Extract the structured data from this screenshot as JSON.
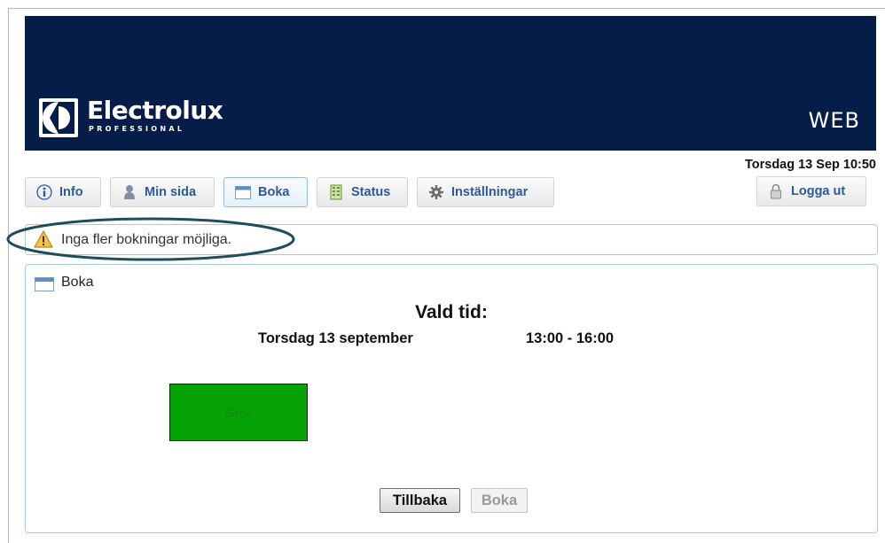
{
  "header": {
    "brand": "Electrolux",
    "brand_sub": "PROFESSIONAL",
    "app_label": "WEB",
    "banner_color": "#071d49"
  },
  "datetime": "Torsdag 13 Sep 10:50",
  "nav": {
    "tabs": [
      {
        "label": "Info",
        "icon": "info-icon"
      },
      {
        "label": "Min sida",
        "icon": "user-icon"
      },
      {
        "label": "Boka",
        "icon": "calendar-icon",
        "active": true
      },
      {
        "label": "Status",
        "icon": "building-icon"
      },
      {
        "label": "Inställningar",
        "icon": "gear-icon"
      }
    ],
    "logout": {
      "label": "Logga ut",
      "icon": "lock-icon"
    }
  },
  "alert": {
    "text": "Inga fler bokningar möjliga.",
    "icon": "warning-icon",
    "highlight_color": "#1e4e5e"
  },
  "panel": {
    "title": "Boka",
    "icon": "calendar-icon",
    "heading": "Vald tid:",
    "day": "Torsdag 13 september",
    "time": "13:00 - 16:00",
    "slot": {
      "label": "Grov",
      "color": "#05a305"
    },
    "buttons": {
      "back": "Tillbaka",
      "book": "Boka"
    }
  }
}
